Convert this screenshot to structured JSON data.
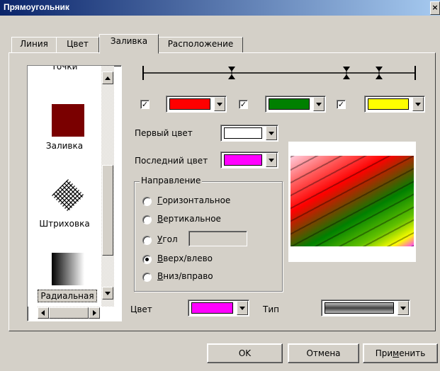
{
  "window": {
    "title": "Прямоугольник",
    "close_glyph": "×"
  },
  "tabs": [
    "Линия",
    "Цвет",
    "Заливка",
    "Расположение"
  ],
  "active_tab": "Заливка",
  "fill_list": {
    "items": [
      "Точки",
      "Заливка",
      "Штриховка",
      "Радиальная"
    ],
    "selected": "Радиальная"
  },
  "gradient_stops": {
    "colors": [
      "#ff0000",
      "#008000",
      "#ffff00"
    ],
    "checked": [
      true,
      true,
      true
    ]
  },
  "first_color": {
    "label": "Первый цвет",
    "value": "#ffffff"
  },
  "last_color": {
    "label": "Последний цвет",
    "value": "#ff00ff"
  },
  "direction": {
    "legend": "Направление",
    "options": [
      {
        "u": "Г",
        "rest": "оризонтальное"
      },
      {
        "u": "В",
        "rest": "ертикальное"
      },
      {
        "u": "У",
        "rest": "гол"
      },
      {
        "u": "В",
        "rest": "верх/влево"
      },
      {
        "u": "В",
        "rest": "низ/вправо"
      }
    ],
    "selected_index": 3,
    "angle_value": ""
  },
  "bottom": {
    "color_label": "Цвет",
    "color_value": "#ff00ff",
    "type_label": "Тип"
  },
  "buttons": {
    "ok": "OK",
    "cancel": "Отмена",
    "apply_pre": "При",
    "apply_u": "м",
    "apply_post": "енить"
  }
}
